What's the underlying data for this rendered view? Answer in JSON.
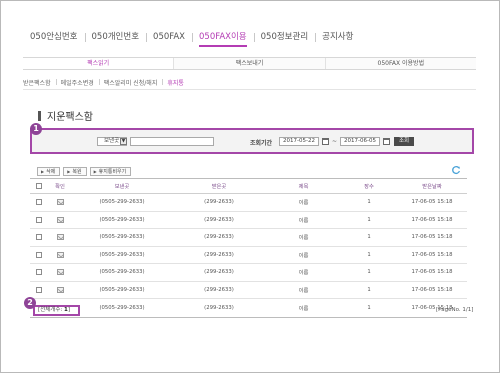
{
  "topnav": {
    "items": [
      {
        "label": "050안심번호",
        "active": false
      },
      {
        "label": "050개인번호",
        "active": false
      },
      {
        "label": "050FAX",
        "active": false
      },
      {
        "label": "050FAX이용",
        "active": true
      },
      {
        "label": "050정보관리",
        "active": false
      },
      {
        "label": "공지사항",
        "active": false
      }
    ]
  },
  "subtabs": [
    {
      "label": "팩스읽기",
      "active": true
    },
    {
      "label": "팩스보내기",
      "active": false
    },
    {
      "label": "050FAX 이용방법",
      "active": false
    }
  ],
  "thirdnav": [
    {
      "label": "받은팩스함",
      "active": false
    },
    {
      "label": "메일주소변경",
      "active": false
    },
    {
      "label": "팩스알리미 신청/해지",
      "active": false
    },
    {
      "label": "휴지통",
      "active": true
    }
  ],
  "page_title": "지운팩스함",
  "search": {
    "badge": "1",
    "field_select": "보낸곳",
    "dropdown_glyph": "▼",
    "keyword": "",
    "period_label": "조회기간",
    "date_from": "2017-05-22",
    "tilde": "~",
    "date_to": "2017-06-05",
    "button": "조회"
  },
  "actions": {
    "delete": "삭제",
    "restore": "복원",
    "empty_trash": "휴지통비우기",
    "arrow": "▶"
  },
  "table": {
    "headers": {
      "view": "확인",
      "sender": "보낸곳",
      "receiver": "받은곳",
      "title": "제목",
      "pages": "장수",
      "date": "받은날짜"
    },
    "rows": [
      {
        "sender": "(0505-299-2633)",
        "receiver": "(299-2633)",
        "title": "이름",
        "pages": "1",
        "date": "17-06-05 15:18"
      },
      {
        "sender": "(0505-299-2633)",
        "receiver": "(299-2633)",
        "title": "이름",
        "pages": "1",
        "date": "17-06-05 15:18"
      },
      {
        "sender": "(0505-299-2633)",
        "receiver": "(299-2633)",
        "title": "이름",
        "pages": "1",
        "date": "17-06-05 15:18"
      },
      {
        "sender": "(0505-299-2633)",
        "receiver": "(299-2633)",
        "title": "이름",
        "pages": "1",
        "date": "17-06-05 15:18"
      },
      {
        "sender": "(0505-299-2633)",
        "receiver": "(299-2633)",
        "title": "이름",
        "pages": "1",
        "date": "17-06-05 15:18"
      },
      {
        "sender": "(0505-299-2633)",
        "receiver": "(299-2633)",
        "title": "이름",
        "pages": "1",
        "date": "17-06-05 15:18"
      },
      {
        "sender": "(0505-299-2633)",
        "receiver": "(299-2633)",
        "title": "이름",
        "pages": "1",
        "date": "17-06-05 15:18"
      }
    ]
  },
  "footer": {
    "badge": "2",
    "total_label": "[전체개수:",
    "total_count": "1",
    "total_close": "]",
    "pageno": "[PageNo. 1/1]"
  },
  "colors": {
    "accent": "#b43cb4",
    "highlight_border": "#a447a8",
    "badge": "#8e4497",
    "search_button": "#4a4a4a",
    "refresh": "#4aa3d8"
  },
  "icons": {
    "refresh": "refresh-icon",
    "calendar": "calendar-icon",
    "view": "mail-icon"
  }
}
